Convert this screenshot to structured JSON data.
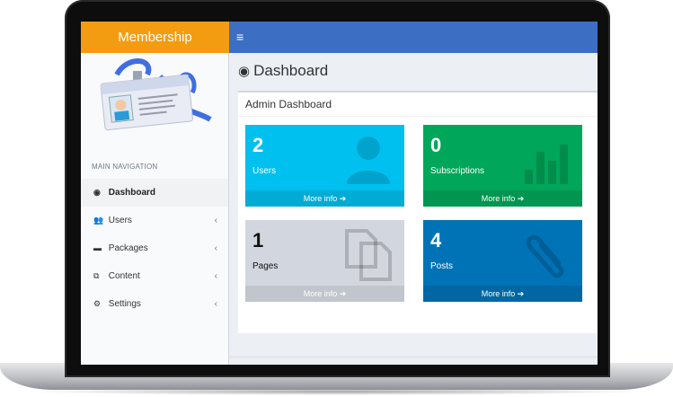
{
  "brand": {
    "title": "Membership",
    "color": "#f39c12"
  },
  "topbar": {
    "color": "#3c6fc4",
    "toggle_icon": "hamburger-icon",
    "toggle_glyph": "≡"
  },
  "sidebar": {
    "header": "MAIN NAVIGATION",
    "items": [
      {
        "label": "Dashboard",
        "icon": "tachometer-icon",
        "glyph": "◉",
        "active": true
      },
      {
        "label": "Users",
        "icon": "users-icon",
        "glyph": "👥",
        "chevron": "‹"
      },
      {
        "label": "Packages",
        "icon": "briefcase-icon",
        "glyph": "▬",
        "chevron": "‹"
      },
      {
        "label": "Content",
        "icon": "copy-icon",
        "glyph": "⧉",
        "chevron": "‹"
      },
      {
        "label": "Settings",
        "icon": "cogs-icon",
        "glyph": "⚙",
        "chevron": "‹"
      }
    ]
  },
  "page": {
    "title": "Dashboard",
    "title_icon": "tachometer-icon"
  },
  "box": {
    "title": "Admin Dashboard"
  },
  "tiles": [
    {
      "value": "2",
      "label": "Users",
      "more": "More info ➔",
      "color": "#00c0ef",
      "icon": "user-icon"
    },
    {
      "value": "0",
      "label": "Subscriptions",
      "more": "More info ➔",
      "color": "#00a65a",
      "icon": "bar-chart-icon"
    },
    {
      "value": "1",
      "label": "Pages",
      "more": "More info ➔",
      "color": "#d2d6de",
      "icon": "files-icon"
    },
    {
      "value": "4",
      "label": "Posts",
      "more": "More info ➔",
      "color": "#0073b7",
      "icon": "paperclip-icon"
    }
  ]
}
